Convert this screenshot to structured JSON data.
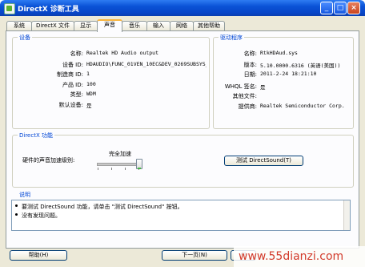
{
  "window": {
    "title": "DirectX 诊断工具",
    "title_icon": "directx-app-icon"
  },
  "title_buttons": {
    "minimize": "_",
    "maximize": "□",
    "close": "×"
  },
  "tabs": [
    {
      "label": "系统",
      "active": false
    },
    {
      "label": "DirectX 文件",
      "active": false
    },
    {
      "label": "显示",
      "active": false
    },
    {
      "label": "声音",
      "active": true
    },
    {
      "label": "音乐",
      "active": false
    },
    {
      "label": "输入",
      "active": false
    },
    {
      "label": "网络",
      "active": false
    },
    {
      "label": "其他帮助",
      "active": false
    }
  ],
  "device": {
    "title": "设备",
    "rows": [
      {
        "label": "名称:",
        "value": "Realtek HD Audio output"
      },
      {
        "label": "设备 ID:",
        "value": "HDAUDIO\\FUNC_01VEN_10EC&DEV_0269SUBSYS_10"
      },
      {
        "label": "制造商 ID:",
        "value": "1"
      },
      {
        "label": "产品 ID:",
        "value": "100"
      },
      {
        "label": "类型:",
        "value": "WDM"
      },
      {
        "label": "默认设备:",
        "value": "是"
      }
    ]
  },
  "driver": {
    "title": "驱动程序",
    "rows": [
      {
        "label": "名称:",
        "value": "RtkHDAud.sys"
      },
      {
        "label": "版本:",
        "value": "5.10.0000.6316 (英语(美国))"
      },
      {
        "label": "日期:",
        "value": "2011-2-24 18:21:10"
      },
      {
        "label": "WHQL 签名:",
        "value": "是"
      },
      {
        "label": "其他文件:",
        "value": ""
      },
      {
        "label": "提供商:",
        "value": "Realtek Semiconductor Corp."
      }
    ]
  },
  "directx": {
    "title": "DirectX 功能",
    "accel_label": "硬件的声音加速级别:",
    "accel_value": "完全加速",
    "accel_level": 1.0,
    "test_button": "测试 DirectSound(T)"
  },
  "notes": {
    "title": "说明",
    "items": [
      "要测试 DirectSound 功能，请单击 \"测试 DirectSound\" 按钮。",
      "没有发现问题。"
    ]
  },
  "buttons": {
    "help": "帮助(H)",
    "next": "下一页(N)",
    "save": "保"
  },
  "watermark": "www.55dianzi.com",
  "colors": {
    "titlebar": "#0846c8",
    "group_title": "#0046d5",
    "active_tab_accent": "#f8b33c",
    "panel_bg": "#ece9d8"
  }
}
